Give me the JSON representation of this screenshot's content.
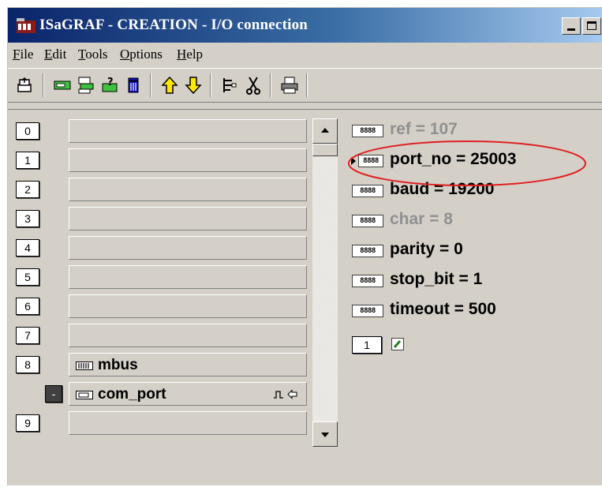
{
  "window": {
    "title": "ISaGRAF - CREATION - I/O connection",
    "minimize_glyph": "_",
    "maximize_glyph": "□"
  },
  "menu": [
    {
      "label": "File",
      "underline": "F",
      "rest": "ile"
    },
    {
      "label": "Edit",
      "underline": "E",
      "rest": "dit"
    },
    {
      "label": "Tools",
      "underline": "T",
      "rest": "ools"
    },
    {
      "label": "Options",
      "underline": "O",
      "rest": "ptions"
    },
    {
      "label": "Help",
      "underline": "H",
      "rest": "elp"
    }
  ],
  "toolbar": [
    {
      "icon": "open-board-icon"
    },
    {
      "icon": "connect-board-icon"
    },
    {
      "icon": "board-params-icon"
    },
    {
      "icon": "set-board-icon"
    },
    {
      "icon": "delete-icon"
    },
    {
      "icon": "arrow-up-icon"
    },
    {
      "icon": "arrow-down-icon"
    },
    {
      "icon": "channel-list-icon"
    },
    {
      "icon": "cut-icon"
    },
    {
      "icon": "print-icon"
    }
  ],
  "slots": {
    "s0": {
      "number": "0",
      "label": ""
    },
    "s1": {
      "number": "1",
      "label": ""
    },
    "s2": {
      "number": "2",
      "label": ""
    },
    "s3": {
      "number": "3",
      "label": ""
    },
    "s4": {
      "number": "4",
      "label": ""
    },
    "s5": {
      "number": "5",
      "label": ""
    },
    "s6": {
      "number": "6",
      "label": ""
    },
    "s7": {
      "number": "7",
      "label": ""
    },
    "s8": {
      "number": "8",
      "label": "mbus"
    },
    "sub": {
      "number": "-",
      "label": "com_port"
    },
    "s9": {
      "number": "9",
      "label": ""
    }
  },
  "parameters": {
    "ref": {
      "text": "ref = 107",
      "enabled": false
    },
    "port_no": {
      "text": "port_no = 25003",
      "enabled": true,
      "selected": true
    },
    "baud": {
      "text": "baud = 19200",
      "enabled": true
    },
    "char": {
      "text": "char = 8",
      "enabled": false
    },
    "parity": {
      "text": "parity = 0",
      "enabled": true
    },
    "stop_bit": {
      "text": "stop_bit = 1",
      "enabled": true
    },
    "timeout": {
      "text": "timeout = 500",
      "enabled": true
    }
  },
  "channel": {
    "number": "1"
  },
  "param_icon_text": "8888",
  "annotation": {
    "color": "#e02020",
    "target": "port_no"
  }
}
